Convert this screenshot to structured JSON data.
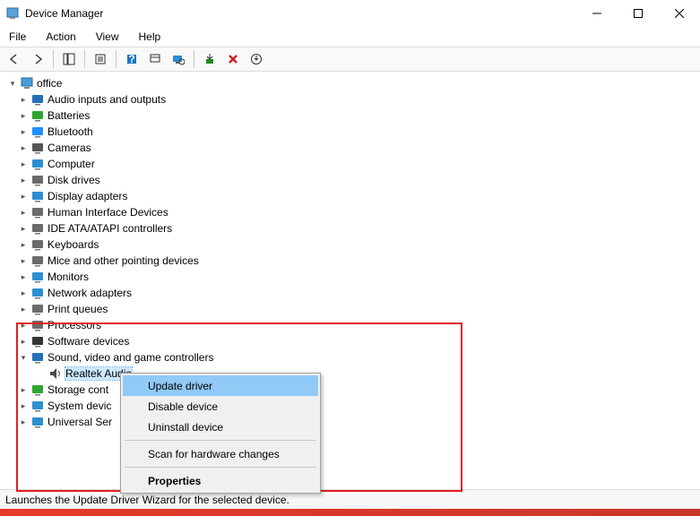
{
  "window": {
    "title": "Device Manager"
  },
  "menubar": [
    "File",
    "Action",
    "View",
    "Help"
  ],
  "root": {
    "label": "office"
  },
  "categories": [
    {
      "label": "Audio inputs and outputs",
      "iconColor": "#2570b5"
    },
    {
      "label": "Batteries",
      "iconColor": "#2fa52f"
    },
    {
      "label": "Bluetooth",
      "iconColor": "#1e90ff"
    },
    {
      "label": "Cameras",
      "iconColor": "#555555"
    },
    {
      "label": "Computer",
      "iconColor": "#2c8fd0"
    },
    {
      "label": "Disk drives",
      "iconColor": "#6b6b6b"
    },
    {
      "label": "Display adapters",
      "iconColor": "#2c8fd0"
    },
    {
      "label": "Human Interface Devices",
      "iconColor": "#6b6b6b"
    },
    {
      "label": "IDE ATA/ATAPI controllers",
      "iconColor": "#6b6b6b"
    },
    {
      "label": "Keyboards",
      "iconColor": "#6b6b6b"
    },
    {
      "label": "Mice and other pointing devices",
      "iconColor": "#6b6b6b"
    },
    {
      "label": "Monitors",
      "iconColor": "#2c8fd0"
    },
    {
      "label": "Network adapters",
      "iconColor": "#2c8fd0"
    },
    {
      "label": "Print queues",
      "iconColor": "#6b6b6b"
    },
    {
      "label": "Processors",
      "iconColor": "#6b6b6b"
    },
    {
      "label": "Software devices",
      "iconColor": "#333333"
    },
    {
      "label": "Sound, video and game controllers",
      "iconColor": "#2570b5",
      "expanded": true,
      "children": [
        {
          "label": "Realtek Audio",
          "selected": true
        }
      ]
    },
    {
      "label": "Storage cont",
      "iconColor": "#2fa52f"
    },
    {
      "label": "System devic",
      "iconColor": "#2c8fd0"
    },
    {
      "label": "Universal Ser",
      "iconColor": "#2c8fd0"
    }
  ],
  "context_menu": {
    "items": [
      {
        "label": "Update driver",
        "hover": true
      },
      {
        "label": "Disable device"
      },
      {
        "label": "Uninstall device"
      },
      {
        "sep": true
      },
      {
        "label": "Scan for hardware changes"
      },
      {
        "sep": true
      },
      {
        "label": "Properties",
        "bold": true
      }
    ]
  },
  "statusbar": "Launches the Update Driver Wizard for the selected device."
}
